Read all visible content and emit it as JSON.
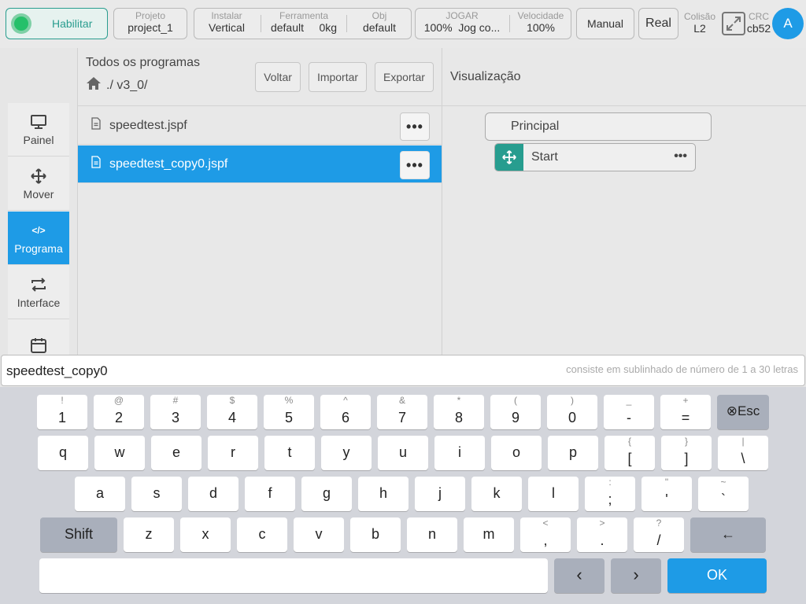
{
  "topbar": {
    "enable_label": "Habilitar",
    "project": {
      "caption": "Projeto",
      "value": "project_1"
    },
    "install": {
      "caption": "Instalar",
      "value": "Vertical"
    },
    "tool": {
      "caption": "Ferramenta",
      "value": "default",
      "payload": "0kg"
    },
    "obj": {
      "caption": "Obj",
      "value": "default"
    },
    "jog": {
      "caption": "JOGAR",
      "percent": "100%",
      "mode": "Jog co..."
    },
    "speed": {
      "caption": "Velocidade",
      "value": "100%"
    },
    "manual_label": "Manual",
    "real_label": "Real",
    "collision": {
      "caption": "Colisão",
      "value": "L2"
    },
    "crc": {
      "caption": "CRC",
      "value": "cb52"
    },
    "avatar_letter": "A",
    "accent": "#1e9be6",
    "enable_color": "#2a9d8f"
  },
  "sidebar": {
    "items": [
      {
        "label": "Painel",
        "icon": "monitor-icon"
      },
      {
        "label": "Mover",
        "icon": "move-icon"
      },
      {
        "label": "Programa",
        "icon": "code-icon",
        "active": true
      },
      {
        "label": "Interface",
        "icon": "swap-arrows-icon"
      },
      {
        "label": "",
        "icon": "calendar-icon"
      }
    ]
  },
  "files": {
    "title": "Todos os programas",
    "path": "./ v3_0/",
    "buttons": {
      "back": "Voltar",
      "import": "Importar",
      "export": "Exportar"
    },
    "list": [
      {
        "name": "speedtest.jspf"
      },
      {
        "name": "speedtest_copy0.jspf",
        "selected": true
      }
    ],
    "more": "•••"
  },
  "viz": {
    "title": "Visualização",
    "root": "Principal",
    "node": "Start",
    "node_more": "•••"
  },
  "input": {
    "value": "speedtest_copy0",
    "hint": "consiste em sublinhado de número de 1 a 30 letras"
  },
  "keyboard": {
    "row1": [
      {
        "sym": "!",
        "key": "1"
      },
      {
        "sym": "@",
        "key": "2"
      },
      {
        "sym": "#",
        "key": "3"
      },
      {
        "sym": "$",
        "key": "4"
      },
      {
        "sym": "%",
        "key": "5"
      },
      {
        "sym": "^",
        "key": "6"
      },
      {
        "sym": "&",
        "key": "7"
      },
      {
        "sym": "*",
        "key": "8"
      },
      {
        "sym": "(",
        "key": "9"
      },
      {
        "sym": ")",
        "key": "0"
      },
      {
        "sym": "_",
        "key": "-"
      },
      {
        "sym": "+",
        "key": "="
      }
    ],
    "esc": "⊗Esc",
    "row2": [
      {
        "sym": "",
        "key": "q"
      },
      {
        "sym": "",
        "key": "w"
      },
      {
        "sym": "",
        "key": "e"
      },
      {
        "sym": "",
        "key": "r"
      },
      {
        "sym": "",
        "key": "t"
      },
      {
        "sym": "",
        "key": "y"
      },
      {
        "sym": "",
        "key": "u"
      },
      {
        "sym": "",
        "key": "i"
      },
      {
        "sym": "",
        "key": "o"
      },
      {
        "sym": "",
        "key": "p"
      },
      {
        "sym": "{",
        "key": "["
      },
      {
        "sym": "}",
        "key": "]"
      },
      {
        "sym": "|",
        "key": "\\"
      }
    ],
    "row3": [
      {
        "sym": "",
        "key": "a"
      },
      {
        "sym": "",
        "key": "s"
      },
      {
        "sym": "",
        "key": "d"
      },
      {
        "sym": "",
        "key": "f"
      },
      {
        "sym": "",
        "key": "g"
      },
      {
        "sym": "",
        "key": "h"
      },
      {
        "sym": "",
        "key": "j"
      },
      {
        "sym": "",
        "key": "k"
      },
      {
        "sym": "",
        "key": "l"
      },
      {
        "sym": ":",
        "key": ";"
      },
      {
        "sym": "\"",
        "key": "'"
      },
      {
        "sym": "~",
        "key": "`"
      }
    ],
    "shift": "Shift",
    "row4": [
      {
        "sym": "",
        "key": "z"
      },
      {
        "sym": "",
        "key": "x"
      },
      {
        "sym": "",
        "key": "c"
      },
      {
        "sym": "",
        "key": "v"
      },
      {
        "sym": "",
        "key": "b"
      },
      {
        "sym": "",
        "key": "n"
      },
      {
        "sym": "",
        "key": "m"
      },
      {
        "sym": "<",
        "key": ","
      },
      {
        "sym": ">",
        "key": "."
      },
      {
        "sym": "?",
        "key": "/"
      }
    ],
    "backspace": "←",
    "left": "‹",
    "right": "›",
    "ok": "OK"
  }
}
